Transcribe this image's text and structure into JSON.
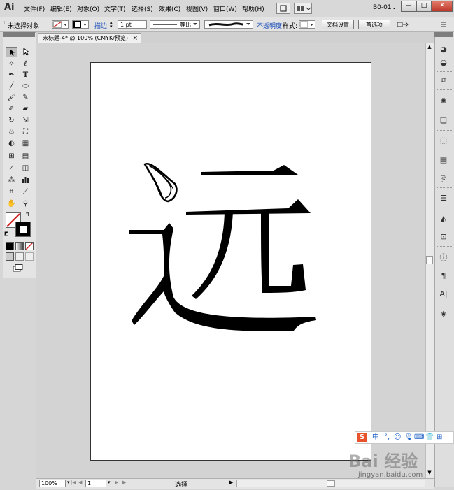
{
  "app": {
    "logo": "Ai"
  },
  "menu": [
    "文件(F)",
    "编辑(E)",
    "对象(O)",
    "文字(T)",
    "选择(S)",
    "效果(C)",
    "视图(V)",
    "窗口(W)",
    "帮助(H)"
  ],
  "workspace": {
    "label": "B0-01",
    "arrow": "⌄"
  },
  "window_buttons": {
    "minimize": "—",
    "maximize": "□",
    "close": "✕"
  },
  "control_bar": {
    "selection_status": "未选择对象",
    "stroke_link": "描边",
    "stroke_weight": "1 pt",
    "profile_label": "等比",
    "opacity_link": "不透明度",
    "style_label": "样式:",
    "doc_setup_button": "文档设置",
    "preferences_button": "首选项"
  },
  "document_tab": {
    "title": "未标题-4* @ 100% (CMYK/预览)",
    "close": "×"
  },
  "status_bar": {
    "zoom": "100%",
    "artboard_number": "1",
    "status_text": "选择"
  },
  "ime_bar": {
    "logo": "S",
    "items": [
      "中",
      "°,",
      "☺",
      "⌨",
      "👕",
      "⊞"
    ]
  },
  "watermark": {
    "brand": "Bai 经验",
    "url": "jingyan.baidu.com"
  },
  "colors": {
    "artboard": "#ffffff",
    "pasteboard": "#d3d3d3",
    "glyph": "#000000",
    "link": "#1b4fb8",
    "close_button": "#c0392b"
  },
  "icons": {
    "tools": [
      "selection-arrow-icon",
      "direct-selection-icon",
      "magic-wand-icon",
      "lasso-icon",
      "pen-icon",
      "type-icon",
      "line-icon",
      "ellipse-icon",
      "paintbrush-icon",
      "pencil-icon",
      "blob-brush-icon",
      "eraser-icon",
      "rotate-icon",
      "scale-icon",
      "warp-icon",
      "free-transform-icon",
      "shape-builder-icon",
      "perspective-grid-icon",
      "mesh-icon",
      "gradient-icon",
      "eyedropper-icon",
      "blend-icon",
      "symbol-sprayer-icon",
      "column-graph-icon",
      "artboard-icon",
      "slice-icon",
      "hand-icon",
      "zoom-icon"
    ],
    "dock": [
      "color-icon",
      "color-guide-icon",
      "swatches-icon",
      "brushes-icon",
      "symbols-icon",
      "graphic-styles-icon",
      "appearance-icon",
      "layers-icon",
      "align-icon",
      "transform-icon",
      "pathfinder-icon",
      "stroke-icon",
      "gradient-panel-icon",
      "transparency-icon",
      "links-icon",
      "paragraph-icon",
      "character-icon",
      "layers-stack-icon"
    ]
  }
}
